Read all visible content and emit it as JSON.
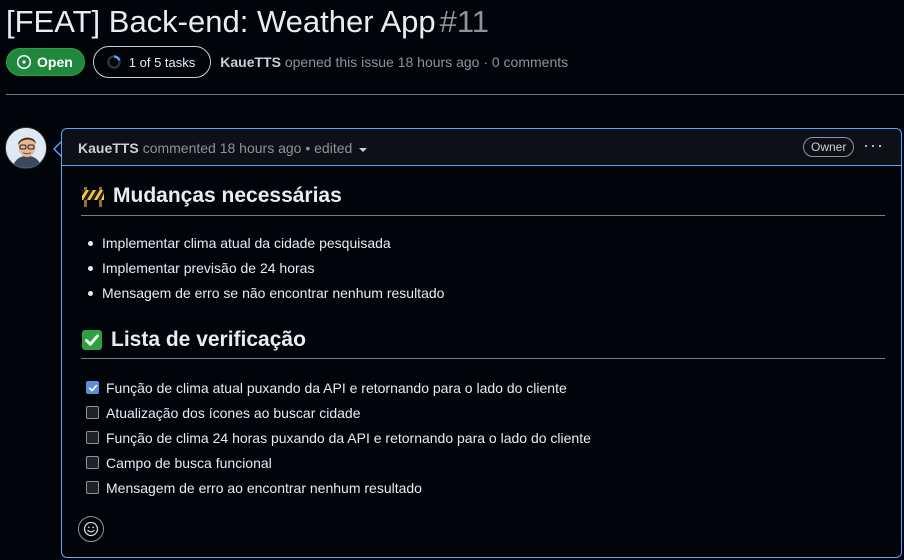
{
  "issue": {
    "title": "[FEAT] Back-end: Weather App",
    "number": "#11",
    "state_label": "Open",
    "tasks_label": "1 of 5 tasks",
    "tasks_done": 1,
    "tasks_total": 5,
    "author": "KaueTTS",
    "opened_text": "opened this issue 18 hours ago · 0 comments"
  },
  "comment": {
    "author": "KaueTTS",
    "meta_text": "commented 18 hours ago • edited",
    "role_badge": "Owner",
    "more_label": "···",
    "section1": {
      "icon": "construction-barrier-icon",
      "heading": "Mudanças necessárias",
      "bullets": [
        "Implementar clima atual da cidade pesquisada",
        "Implementar previsão de 24 horas",
        "Mensagem de erro se não encontrar nenhum resultado"
      ]
    },
    "section2": {
      "icon": "check-mark-button-icon",
      "heading": "Lista de verificação",
      "tasks": [
        {
          "label": "Função de clima atual puxando da API e retornando para o lado do cliente",
          "checked": true
        },
        {
          "label": "Atualização dos ícones ao buscar cidade",
          "checked": false
        },
        {
          "label": "Função de clima 24 horas puxando da API e retornando para o lado do cliente",
          "checked": false
        },
        {
          "label": "Campo de busca funcional",
          "checked": false
        },
        {
          "label": "Mensagem de erro ao encontrar nenhum resultado",
          "checked": false
        }
      ]
    }
  },
  "colors": {
    "open_green": "#1f883d",
    "accent_blue": "#58a6ff",
    "checkbox_blue": "#5b8fd8",
    "background": "#010409"
  }
}
